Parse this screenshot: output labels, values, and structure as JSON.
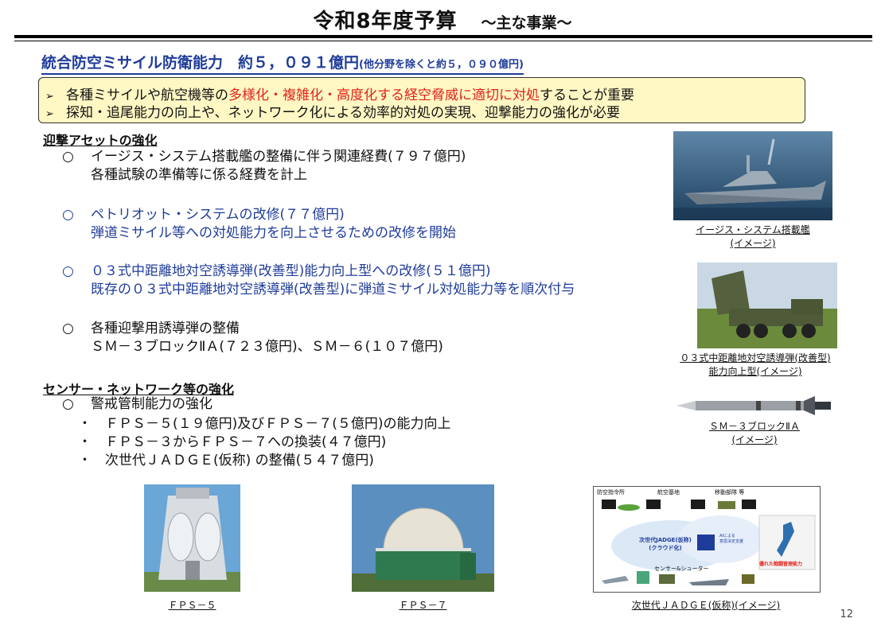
{
  "header": {
    "title": "令和8年度予算",
    "subtitle": "～主な事業～"
  },
  "section": {
    "title": "統合防空ミサイル防衛能力　約５，０９１億円",
    "note": "(他分野を除くと約５，０９０億円)"
  },
  "callout": {
    "arrow": "➢",
    "line1_pre": "各種ミサイルや航空機等の",
    "line1_red": "多様化・複雑化・高度化する経空脅威に適切に対処",
    "line1_post": "することが重要",
    "line2": "探知・追尾能力の向上や、ネットワーク化による効率的対処の実現、迎撃能力の強化が必要"
  },
  "interception": {
    "heading": "迎撃アセットの強化",
    "items": [
      {
        "mark": "○",
        "line1": "イージス・システム搭載艦の整備に伴う関連経費(７９７億円)",
        "line2": "各種試験の準備等に係る経費を計上"
      },
      {
        "mark": "○",
        "line1": "ペトリオット・システムの改修(７７億円)",
        "line2": "弾道ミサイル等への対処能力を向上させるための改修を開始"
      },
      {
        "mark": "○",
        "line1": "０３式中距離地対空誘導弾(改善型)能力向上型への改修(５１億円)",
        "line2": "既存の０３式中距離地対空誘導弾(改善型)に弾道ミサイル対処能力等を順次付与"
      },
      {
        "mark": "○",
        "line1": "各種迎撃用誘導弾の整備",
        "line2": "ＳＭ－３ブロックⅡＡ(７２３億円)、ＳＭ－６(１０７億円)"
      }
    ]
  },
  "sensor": {
    "heading": "センサー・ネットワーク等の強化",
    "mark": "○",
    "item": "警戒管制能力の強化",
    "bullet": "・",
    "bullets": [
      "ＦＰＳ－５(１９億円)及びＦＰＳ－７(５億円)の能力向上",
      "ＦＰＳ－３からＦＰＳ－７への換装(４７億円)",
      "次世代ＪＡＤＧＥ(仮称) の整備(５４７億円)"
    ]
  },
  "figures": {
    "ship_caption1": "イージス・システム搭載艦",
    "ship_caption2": "(イメージ)",
    "sam_caption1": "０３式中距離地対空誘導弾(改善型)",
    "sam_caption2": "能力向上型(イメージ)",
    "sm3_caption1": "ＳＭ－３ブロックⅡＡ",
    "sm3_caption2": "(イメージ)",
    "fps5_caption": "ＦＰＳ－５",
    "fps7_caption": "ＦＰＳ－７",
    "jadge_caption": "次世代ＪＡＤＧＥ(仮称)(イメージ)"
  },
  "jadge_diagram": {
    "top_labels": [
      "防空指令所",
      "航空基地",
      "移動部隊 等"
    ],
    "cloud_line1": "次世代JADGE(仮称)",
    "cloud_line2": "(クラウド化)",
    "ai_line1": "AIによる",
    "ai_line2": "意思決定支援",
    "sensor_label": "センサー&シューター",
    "map_label": "優れた戦闘管理能力"
  },
  "page_number": "12",
  "colors": {
    "accent_blue": "#1f3c9a",
    "alert_red": "#e0231a",
    "callout_bg": "#fff7c4"
  }
}
